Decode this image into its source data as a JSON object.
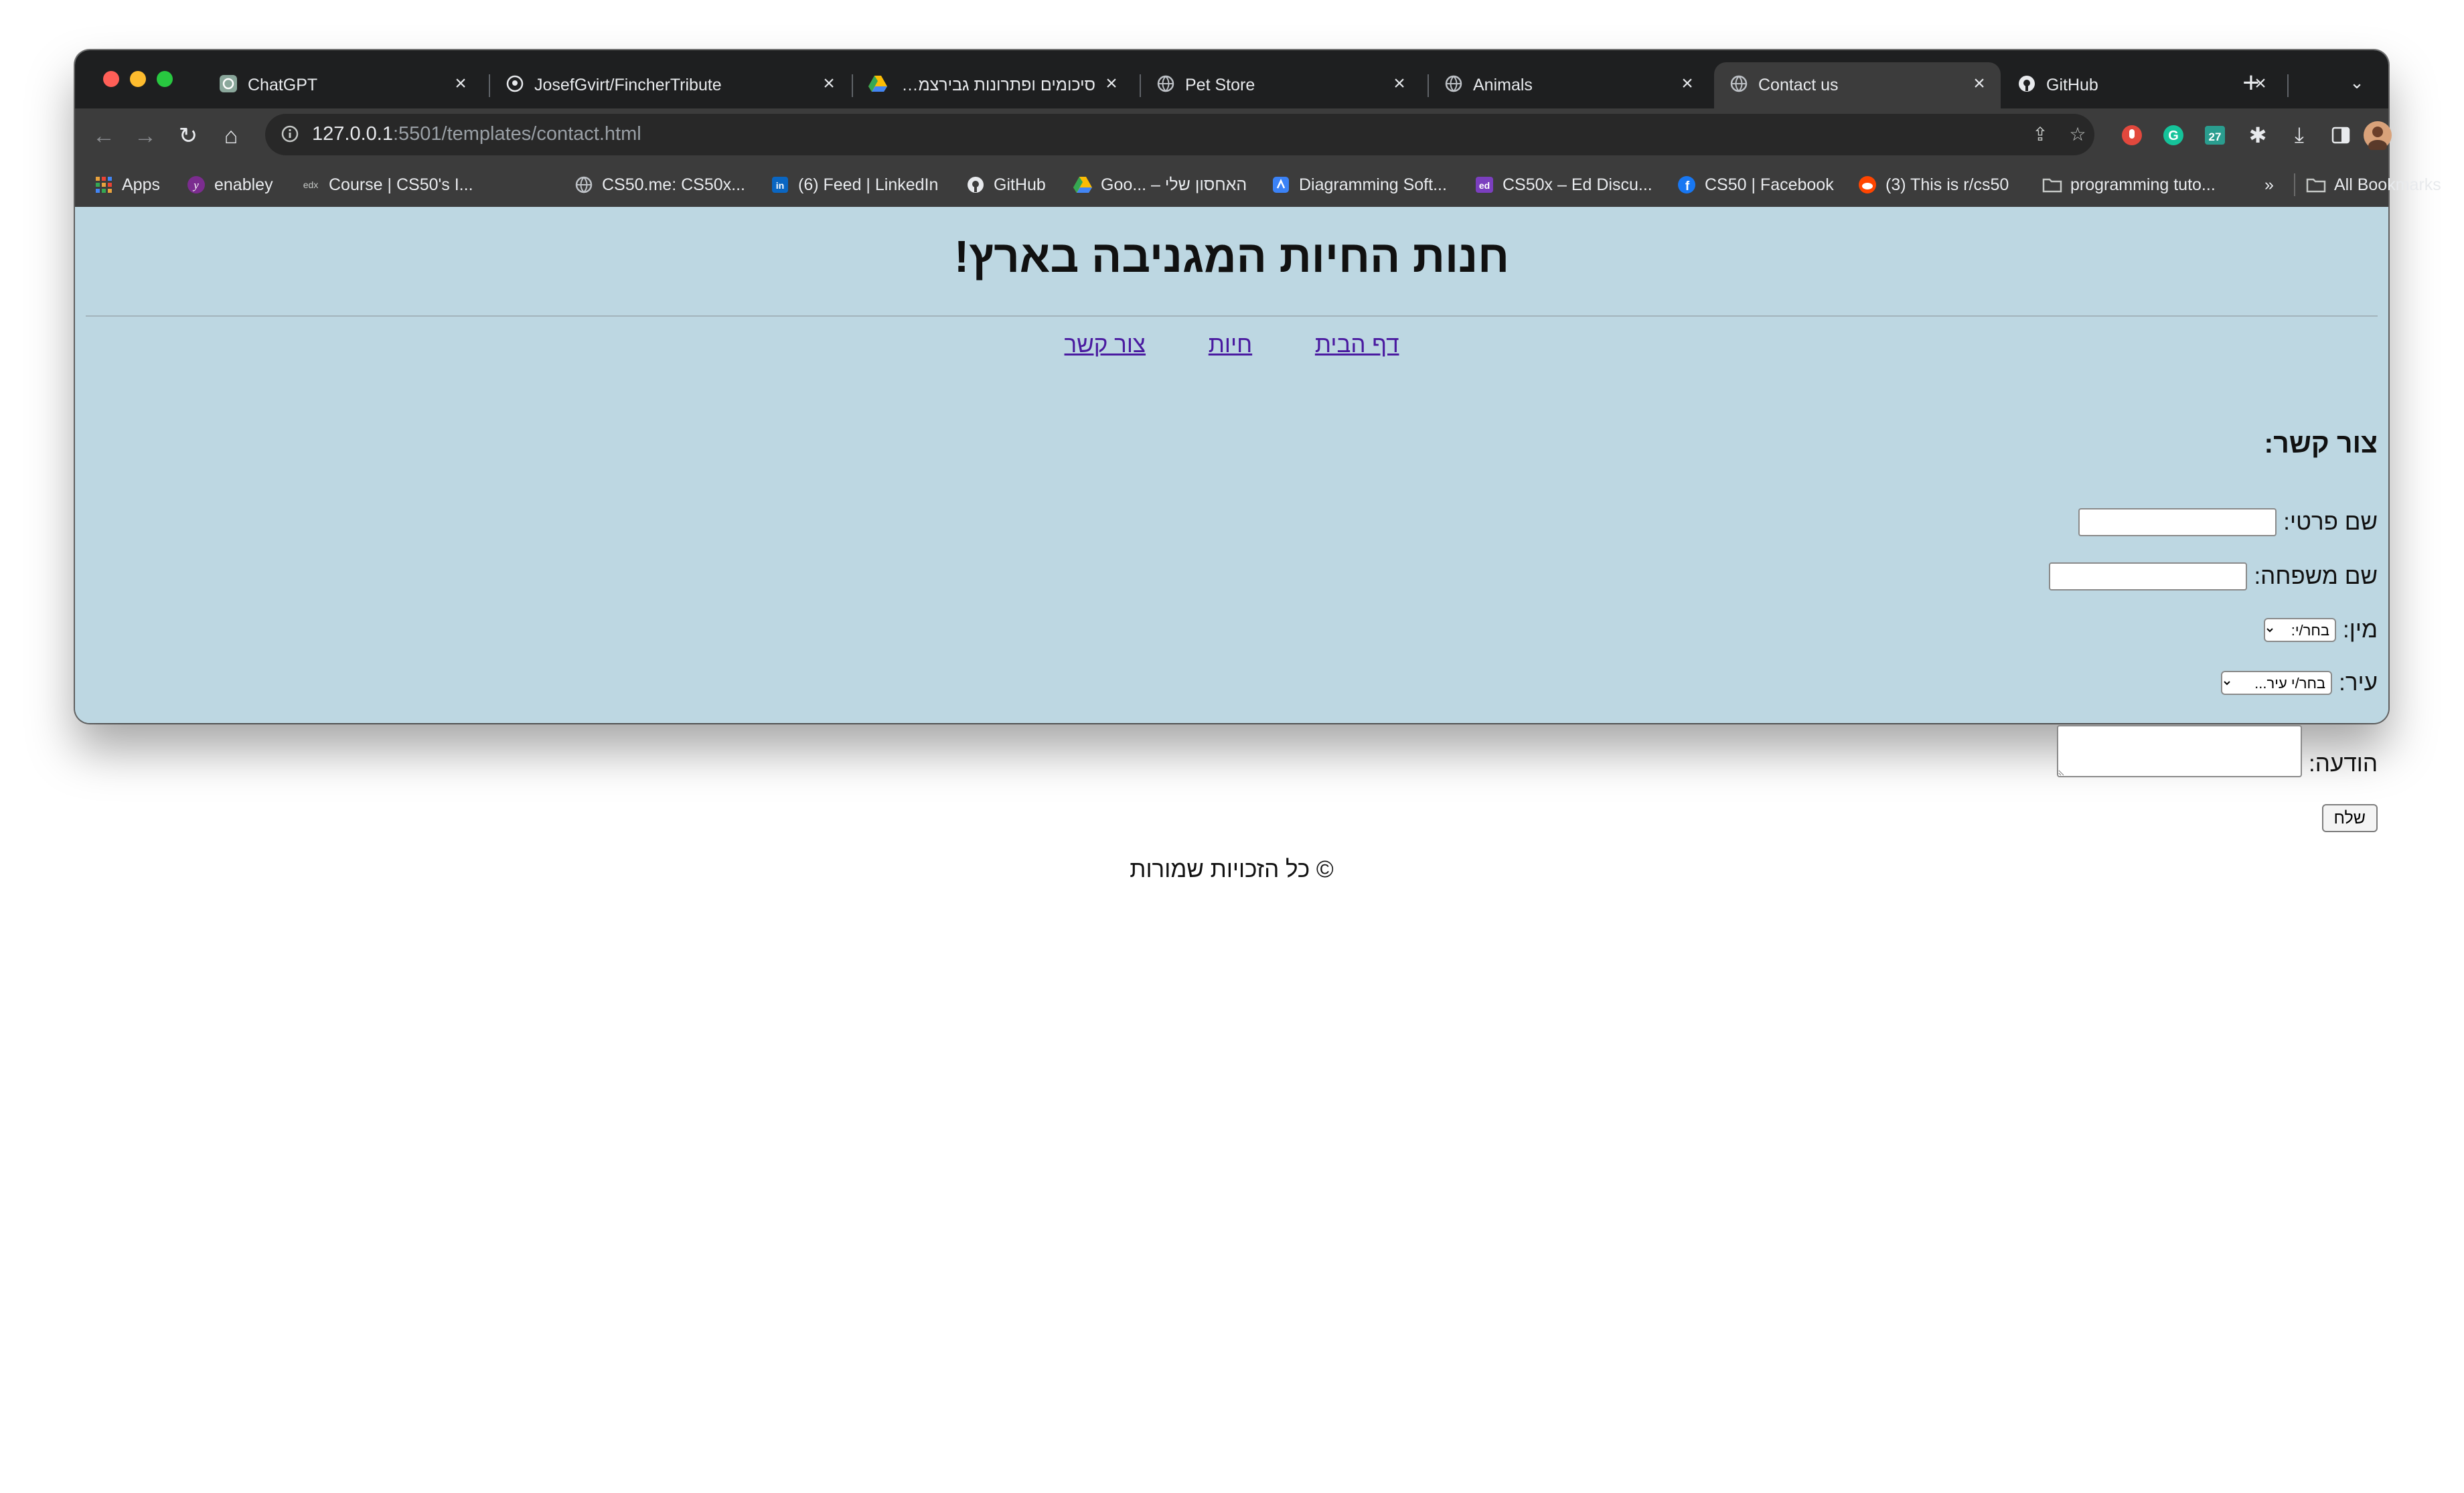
{
  "browser": {
    "tabs": [
      {
        "title": "ChatGPT",
        "icon": "chatgpt-icon",
        "active": false
      },
      {
        "title": "JosefGvirt/FincherTribute",
        "icon": "github-icon",
        "active": false
      },
      {
        "title": "סיכומים ופתרונות גבירצמן יוו",
        "icon": "google-drive-icon",
        "active": false
      },
      {
        "title": "Pet Store",
        "icon": "globe-icon",
        "active": false
      },
      {
        "title": "Animals",
        "icon": "globe-icon",
        "active": false
      },
      {
        "title": "Contact us",
        "icon": "globe-icon",
        "active": true
      },
      {
        "title": "GitHub",
        "icon": "github-icon",
        "active": false
      }
    ],
    "address": {
      "host": "127.0.0.1",
      "rest": ":5501/templates/contact.html"
    },
    "bookmarks": [
      {
        "label": "Apps",
        "icon": "apps-grid-icon"
      },
      {
        "label": "enabley",
        "icon": "enabley-icon"
      },
      {
        "label": "Course | CS50's I...",
        "icon": "edx-icon"
      },
      {
        "label": "CS50.me: CS50x...",
        "icon": "globe-icon"
      },
      {
        "label": "(6) Feed | LinkedIn",
        "icon": "linkedin-icon"
      },
      {
        "label": "GitHub",
        "icon": "github-icon"
      },
      {
        "label": "Goo... – האחסון שלי",
        "icon": "google-drive-icon"
      },
      {
        "label": "Diagramming Soft...",
        "icon": "diagram-icon"
      },
      {
        "label": "CS50x – Ed Discu...",
        "icon": "ed-icon"
      },
      {
        "label": "CS50 | Facebook",
        "icon": "facebook-icon"
      },
      {
        "label": "(3) This is r/cs50",
        "icon": "reddit-icon"
      },
      {
        "label": "programming tuto...",
        "icon": "folder-icon"
      }
    ],
    "overflow": "»",
    "all_bookmarks": "All Bookmarks",
    "extension_badge": "27"
  },
  "page": {
    "title": "חנות החיות המגניבה בארץ!",
    "nav": {
      "home": "דף הבית",
      "animals": "חיות",
      "contact": "צור קשר"
    },
    "contact_heading": "צור קשר:",
    "form": {
      "first_name_label": "שם פרטי:",
      "last_name_label": "שם משפחה:",
      "gender_label": "מין:",
      "gender_selected": "בחר/י:",
      "city_label": "עיר:",
      "city_selected": "בחר/י עיר...",
      "message_label": "הודעה:",
      "submit": "שלח"
    },
    "footer": "© כל הזכויות שמורות"
  },
  "colors": {
    "page_background": "#bdd7e2",
    "link": "#4a1aa0",
    "chrome_dark": "#1e1f20",
    "toolbar": "#3c3c3c"
  }
}
